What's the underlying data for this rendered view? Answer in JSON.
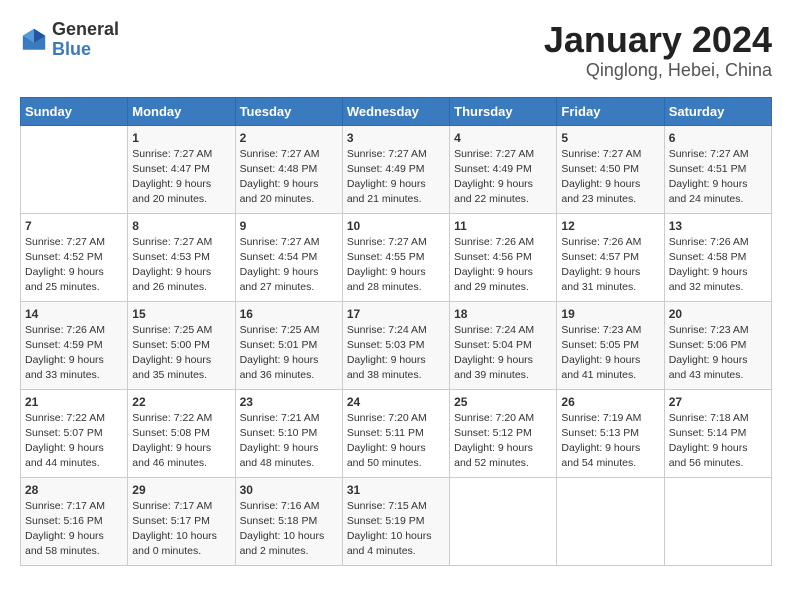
{
  "logo": {
    "general": "General",
    "blue": "Blue"
  },
  "title": "January 2024",
  "location": "Qinglong, Hebei, China",
  "weekdays": [
    "Sunday",
    "Monday",
    "Tuesday",
    "Wednesday",
    "Thursday",
    "Friday",
    "Saturday"
  ],
  "weeks": [
    [
      {
        "day": "",
        "info": ""
      },
      {
        "day": "1",
        "info": "Sunrise: 7:27 AM\nSunset: 4:47 PM\nDaylight: 9 hours\nand 20 minutes."
      },
      {
        "day": "2",
        "info": "Sunrise: 7:27 AM\nSunset: 4:48 PM\nDaylight: 9 hours\nand 20 minutes."
      },
      {
        "day": "3",
        "info": "Sunrise: 7:27 AM\nSunset: 4:49 PM\nDaylight: 9 hours\nand 21 minutes."
      },
      {
        "day": "4",
        "info": "Sunrise: 7:27 AM\nSunset: 4:49 PM\nDaylight: 9 hours\nand 22 minutes."
      },
      {
        "day": "5",
        "info": "Sunrise: 7:27 AM\nSunset: 4:50 PM\nDaylight: 9 hours\nand 23 minutes."
      },
      {
        "day": "6",
        "info": "Sunrise: 7:27 AM\nSunset: 4:51 PM\nDaylight: 9 hours\nand 24 minutes."
      }
    ],
    [
      {
        "day": "7",
        "info": "Sunrise: 7:27 AM\nSunset: 4:52 PM\nDaylight: 9 hours\nand 25 minutes."
      },
      {
        "day": "8",
        "info": "Sunrise: 7:27 AM\nSunset: 4:53 PM\nDaylight: 9 hours\nand 26 minutes."
      },
      {
        "day": "9",
        "info": "Sunrise: 7:27 AM\nSunset: 4:54 PM\nDaylight: 9 hours\nand 27 minutes."
      },
      {
        "day": "10",
        "info": "Sunrise: 7:27 AM\nSunset: 4:55 PM\nDaylight: 9 hours\nand 28 minutes."
      },
      {
        "day": "11",
        "info": "Sunrise: 7:26 AM\nSunset: 4:56 PM\nDaylight: 9 hours\nand 29 minutes."
      },
      {
        "day": "12",
        "info": "Sunrise: 7:26 AM\nSunset: 4:57 PM\nDaylight: 9 hours\nand 31 minutes."
      },
      {
        "day": "13",
        "info": "Sunrise: 7:26 AM\nSunset: 4:58 PM\nDaylight: 9 hours\nand 32 minutes."
      }
    ],
    [
      {
        "day": "14",
        "info": "Sunrise: 7:26 AM\nSunset: 4:59 PM\nDaylight: 9 hours\nand 33 minutes."
      },
      {
        "day": "15",
        "info": "Sunrise: 7:25 AM\nSunset: 5:00 PM\nDaylight: 9 hours\nand 35 minutes."
      },
      {
        "day": "16",
        "info": "Sunrise: 7:25 AM\nSunset: 5:01 PM\nDaylight: 9 hours\nand 36 minutes."
      },
      {
        "day": "17",
        "info": "Sunrise: 7:24 AM\nSunset: 5:03 PM\nDaylight: 9 hours\nand 38 minutes."
      },
      {
        "day": "18",
        "info": "Sunrise: 7:24 AM\nSunset: 5:04 PM\nDaylight: 9 hours\nand 39 minutes."
      },
      {
        "day": "19",
        "info": "Sunrise: 7:23 AM\nSunset: 5:05 PM\nDaylight: 9 hours\nand 41 minutes."
      },
      {
        "day": "20",
        "info": "Sunrise: 7:23 AM\nSunset: 5:06 PM\nDaylight: 9 hours\nand 43 minutes."
      }
    ],
    [
      {
        "day": "21",
        "info": "Sunrise: 7:22 AM\nSunset: 5:07 PM\nDaylight: 9 hours\nand 44 minutes."
      },
      {
        "day": "22",
        "info": "Sunrise: 7:22 AM\nSunset: 5:08 PM\nDaylight: 9 hours\nand 46 minutes."
      },
      {
        "day": "23",
        "info": "Sunrise: 7:21 AM\nSunset: 5:10 PM\nDaylight: 9 hours\nand 48 minutes."
      },
      {
        "day": "24",
        "info": "Sunrise: 7:20 AM\nSunset: 5:11 PM\nDaylight: 9 hours\nand 50 minutes."
      },
      {
        "day": "25",
        "info": "Sunrise: 7:20 AM\nSunset: 5:12 PM\nDaylight: 9 hours\nand 52 minutes."
      },
      {
        "day": "26",
        "info": "Sunrise: 7:19 AM\nSunset: 5:13 PM\nDaylight: 9 hours\nand 54 minutes."
      },
      {
        "day": "27",
        "info": "Sunrise: 7:18 AM\nSunset: 5:14 PM\nDaylight: 9 hours\nand 56 minutes."
      }
    ],
    [
      {
        "day": "28",
        "info": "Sunrise: 7:17 AM\nSunset: 5:16 PM\nDaylight: 9 hours\nand 58 minutes."
      },
      {
        "day": "29",
        "info": "Sunrise: 7:17 AM\nSunset: 5:17 PM\nDaylight: 10 hours\nand 0 minutes."
      },
      {
        "day": "30",
        "info": "Sunrise: 7:16 AM\nSunset: 5:18 PM\nDaylight: 10 hours\nand 2 minutes."
      },
      {
        "day": "31",
        "info": "Sunrise: 7:15 AM\nSunset: 5:19 PM\nDaylight: 10 hours\nand 4 minutes."
      },
      {
        "day": "",
        "info": ""
      },
      {
        "day": "",
        "info": ""
      },
      {
        "day": "",
        "info": ""
      }
    ]
  ]
}
